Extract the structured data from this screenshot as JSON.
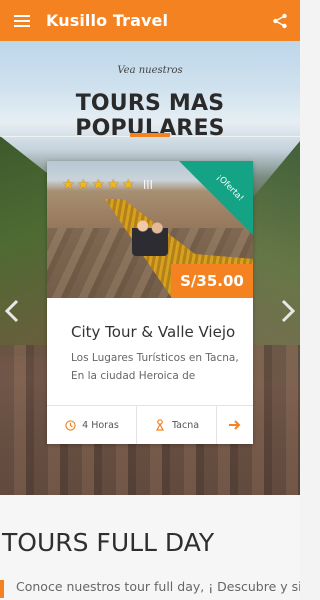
{
  "app": {
    "title": "Kusillo Travel"
  },
  "hero": {
    "subtitle": "Vea nuestros",
    "title": "TOURS MAS POPULARES"
  },
  "card": {
    "offer_badge": "¡Oferta!",
    "price": "S/35.00",
    "title": "City Tour & Valle Viejo",
    "description": "Los Lugares Turísticos en Tacna, En la ciudad Heroica de",
    "rating": {
      "stars": 5,
      "extra": "|||"
    },
    "duration": "4 Horas",
    "location": "Tacna"
  },
  "section2": {
    "title": "TOURS FULL DAY",
    "description": "Conoce nuestros tour full day, ¡ Descubre y siente"
  },
  "colors": {
    "accent": "#f58220",
    "offer": "#15a385"
  },
  "icons": {
    "menu": "menu-icon",
    "share": "share-icon",
    "clock": "clock-icon",
    "location": "location-icon",
    "arrow_right": "arrow-right-icon"
  }
}
